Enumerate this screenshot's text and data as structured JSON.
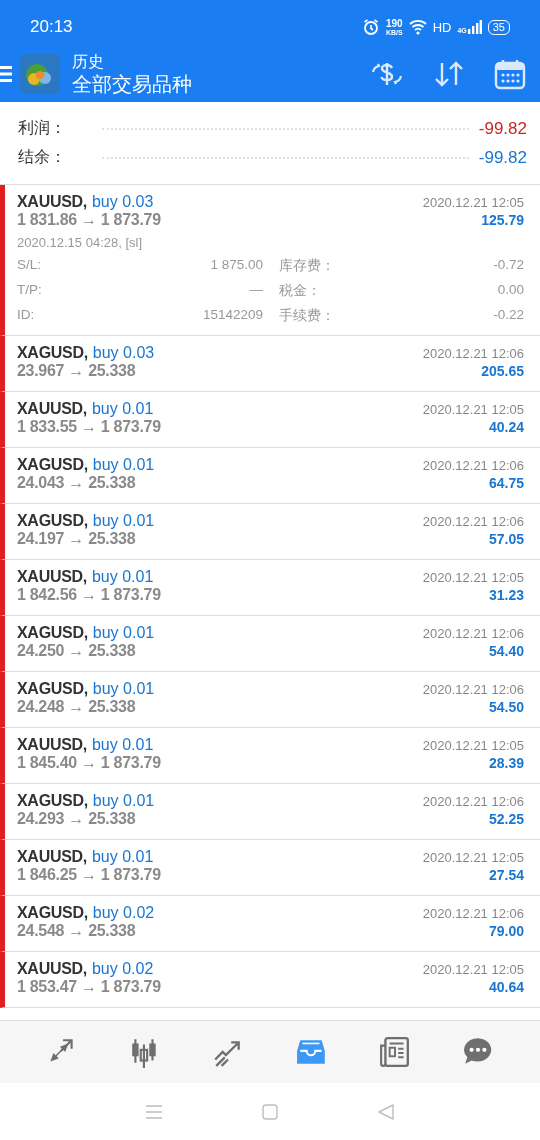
{
  "status_bar": {
    "time": "20:13",
    "speed": "190",
    "speed_unit": "KB/S",
    "hd": "HD",
    "network": "4G",
    "battery": "35"
  },
  "header": {
    "subtitle": "历史",
    "title": "全部交易品种"
  },
  "summary": [
    {
      "label": "利润：",
      "value": "-99.82",
      "color": "#c62828"
    },
    {
      "label": "结余：",
      "value": "-99.82",
      "color": "#1976d2"
    }
  ],
  "trades": [
    {
      "symbol": "XAUUSD,",
      "side": "buy 0.03",
      "prices": "1 831.86 → 1 873.79",
      "time": "2020.12.21 12:05",
      "profit": "125.79",
      "expanded": true,
      "open_info": "2020.12.15 04:28, [sl]",
      "details": [
        {
          "label": "S/L:",
          "value": "1 875.00",
          "label_2": "库存费：",
          "value_2": "-0.72"
        },
        {
          "label": "T/P:",
          "value": "—",
          "label_2": "税金：",
          "value_2": "0.00"
        },
        {
          "label": "ID:",
          "value": "15142209",
          "label_2": "手续费：",
          "value_2": "-0.22"
        }
      ]
    },
    {
      "symbol": "XAGUSD,",
      "side": "buy 0.03",
      "prices": "23.967 → 25.338",
      "time": "2020.12.21 12:06",
      "profit": "205.65",
      "expanded": false
    },
    {
      "symbol": "XAUUSD,",
      "side": "buy 0.01",
      "prices": "1 833.55 → 1 873.79",
      "time": "2020.12.21 12:05",
      "profit": "40.24",
      "expanded": false
    },
    {
      "symbol": "XAGUSD,",
      "side": "buy 0.01",
      "prices": "24.043 → 25.338",
      "time": "2020.12.21 12:06",
      "profit": "64.75",
      "expanded": false
    },
    {
      "symbol": "XAGUSD,",
      "side": "buy 0.01",
      "prices": "24.197 → 25.338",
      "time": "2020.12.21 12:06",
      "profit": "57.05",
      "expanded": false
    },
    {
      "symbol": "XAUUSD,",
      "side": "buy 0.01",
      "prices": "1 842.56 → 1 873.79",
      "time": "2020.12.21 12:05",
      "profit": "31.23",
      "expanded": false
    },
    {
      "symbol": "XAGUSD,",
      "side": "buy 0.01",
      "prices": "24.250 → 25.338",
      "time": "2020.12.21 12:06",
      "profit": "54.40",
      "expanded": false
    },
    {
      "symbol": "XAGUSD,",
      "side": "buy 0.01",
      "prices": "24.248 → 25.338",
      "time": "2020.12.21 12:06",
      "profit": "54.50",
      "expanded": false
    },
    {
      "symbol": "XAUUSD,",
      "side": "buy 0.01",
      "prices": "1 845.40 → 1 873.79",
      "time": "2020.12.21 12:05",
      "profit": "28.39",
      "expanded": false
    },
    {
      "symbol": "XAGUSD,",
      "side": "buy 0.01",
      "prices": "24.293 → 25.338",
      "time": "2020.12.21 12:06",
      "profit": "52.25",
      "expanded": false
    },
    {
      "symbol": "XAUUSD,",
      "side": "buy 0.01",
      "prices": "1 846.25 → 1 873.79",
      "time": "2020.12.21 12:05",
      "profit": "27.54",
      "expanded": false
    },
    {
      "symbol": "XAGUSD,",
      "side": "buy 0.02",
      "prices": "24.548 → 25.338",
      "time": "2020.12.21 12:06",
      "profit": "79.00",
      "expanded": false
    },
    {
      "symbol": "XAUUSD,",
      "side": "buy 0.02",
      "prices": "1 853.47 → 1 873.79",
      "time": "2020.12.21 12:05",
      "profit": "40.64",
      "expanded": false
    }
  ],
  "bottom_nav": [
    {
      "kind": "quotes",
      "selected": false
    },
    {
      "kind": "chart",
      "selected": false
    },
    {
      "kind": "trade",
      "selected": false
    },
    {
      "kind": "history",
      "selected": true
    },
    {
      "kind": "news",
      "selected": false
    },
    {
      "kind": "chat",
      "selected": false
    }
  ]
}
